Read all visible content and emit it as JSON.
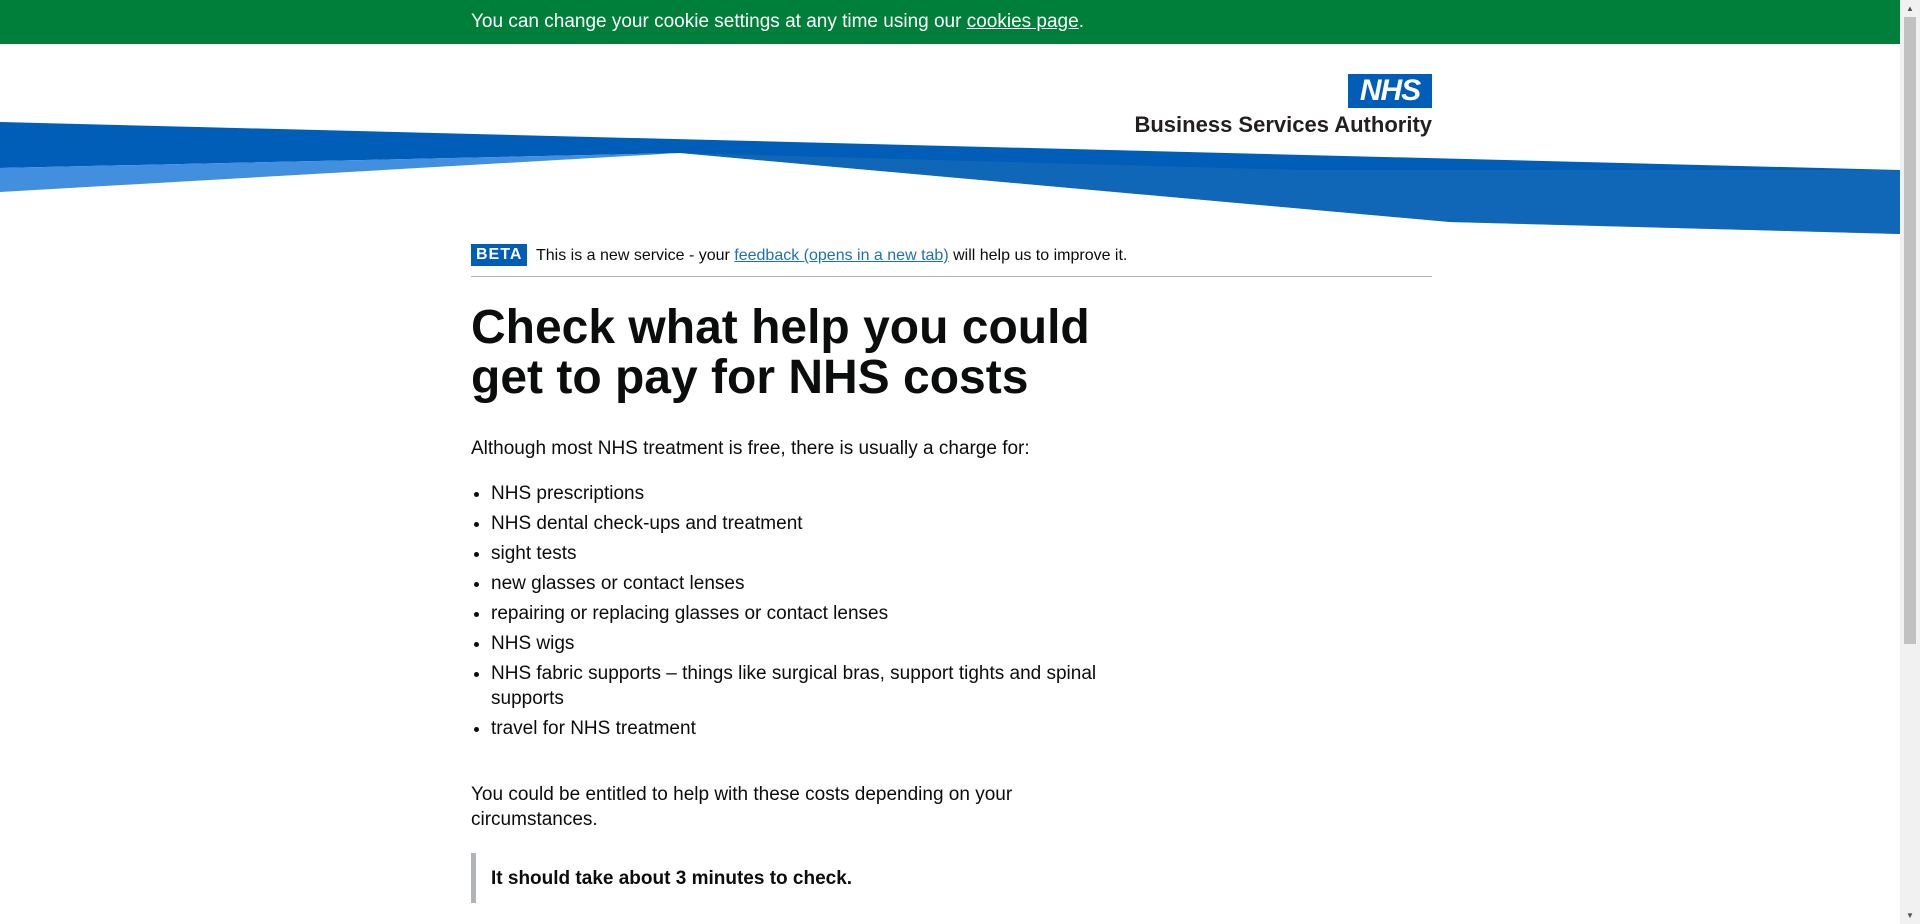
{
  "cookie_banner": {
    "text": "You can change your cookie settings at any time using our ",
    "link": "cookies page",
    "suffix": "."
  },
  "header": {
    "logo_nhs": "NHS",
    "logo_org": "Business Services Authority"
  },
  "beta_banner": {
    "tag": "BETA",
    "text_before": "This is a new service - your ",
    "link": "feedback (opens in a new tab)",
    "text_after": " will help us to improve it."
  },
  "main": {
    "title": "Check what help you could get to pay for NHS costs",
    "intro": "Although most NHS treatment is free, there is usually a charge for:",
    "costs": [
      "NHS prescriptions",
      "NHS dental check-ups and treatment",
      "sight tests",
      "new glasses or contact lenses",
      "repairing or replacing glasses or contact lenses",
      "NHS wigs",
      "NHS fabric supports – things like surgical bras, support tights and spinal supports",
      "travel for NHS treatment"
    ],
    "entitled": "You could be entitled to help with these costs depending on your circumstances.",
    "inset": "It should take about 3 minutes to check."
  },
  "colors": {
    "cookie_banner_bg": "#007f3b",
    "nhs_blue": "#005eb8",
    "link": "#1d70b8",
    "text": "#0b0c0c"
  }
}
